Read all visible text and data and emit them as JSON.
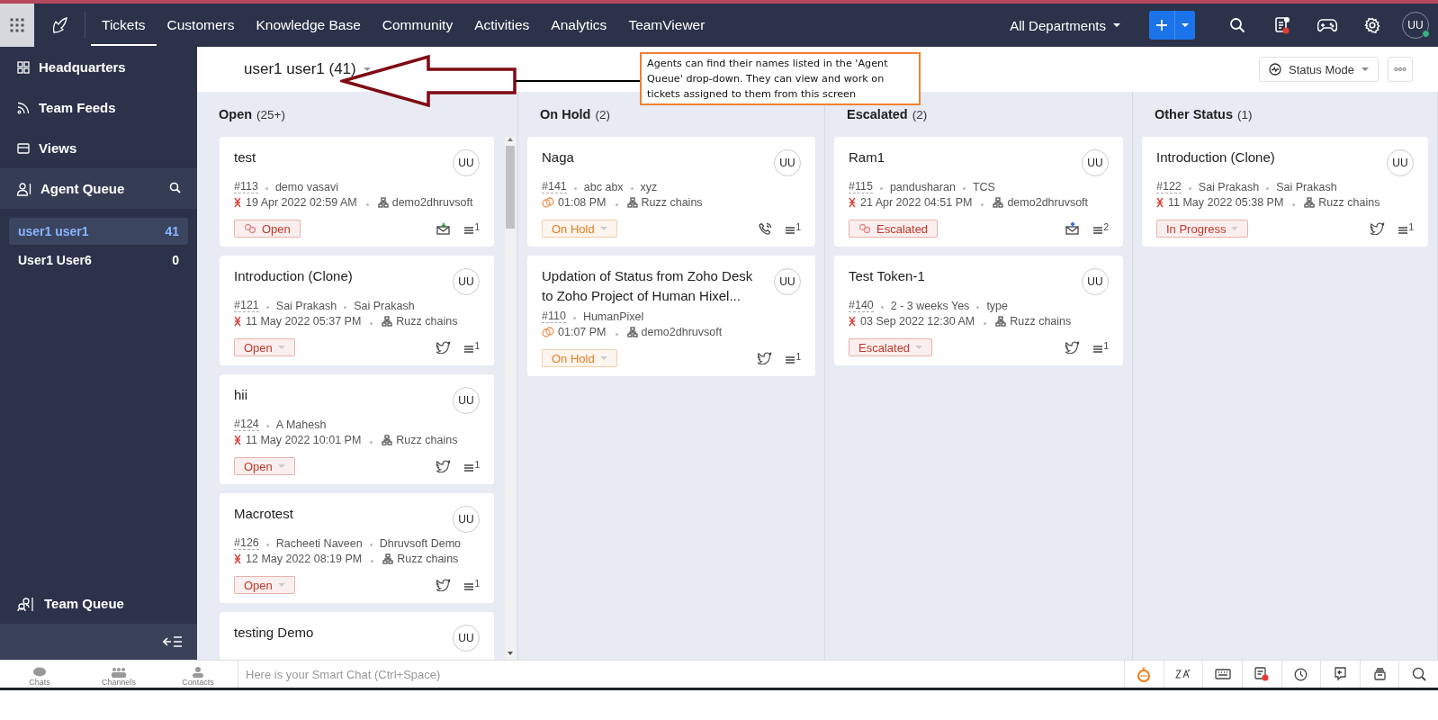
{
  "top_nav": {
    "tabs": [
      {
        "label": "Tickets",
        "selected": true
      },
      {
        "label": "Customers",
        "selected": false
      },
      {
        "label": "Knowledge Base",
        "selected": false
      },
      {
        "label": "Community",
        "selected": false
      },
      {
        "label": "Activities",
        "selected": false
      },
      {
        "label": "Analytics",
        "selected": false
      },
      {
        "label": "TeamViewer",
        "selected": false
      }
    ],
    "department": "All Departments",
    "avatar": "UU"
  },
  "sidebar": {
    "items": [
      {
        "label": "Headquarters",
        "kind": "headquarters",
        "selected": false
      },
      {
        "label": "Team Feeds",
        "kind": "feeds",
        "selected": false
      },
      {
        "label": "Views",
        "kind": "views",
        "selected": false
      },
      {
        "label": "Agent Queue",
        "kind": "agent",
        "selected": true
      }
    ],
    "agents": [
      {
        "name": "user1 user1",
        "count": "41",
        "selected": true
      },
      {
        "name": "User1 User6",
        "count": "0",
        "selected": false
      }
    ],
    "footer_item": "Team Queue"
  },
  "view_header": {
    "title": "user1 user1 (41)",
    "status_mode": "Status Mode"
  },
  "annotation": {
    "text": "Agents can find their names listed in the 'Agent Queue' drop-down. They can view and work on tickets assigned to them from this screen"
  },
  "columns": [
    {
      "title": "Open",
      "count": "(25+)",
      "cards": [
        {
          "subject": "test",
          "number": "#113",
          "meta": [
            "demo vasavi"
          ],
          "time": {
            "kind": "due",
            "text": "19 Apr 2022 02:59 AM"
          },
          "department": "demo2dhruvsoft",
          "status": {
            "label": "Open",
            "color": "#c0392b",
            "linked": true
          },
          "channel": {
            "kind": "email-in"
          },
          "threads": "1",
          "avatar": "UU"
        },
        {
          "subject": "Introduction (Clone)",
          "number": "#121",
          "meta": [
            "Sai Prakash",
            "Sai Prakash"
          ],
          "time": {
            "kind": "due",
            "text": "11 May 2022 05:37 PM"
          },
          "department": "Ruzz chains",
          "status": {
            "label": "Open",
            "color": "#c0392b",
            "linked": false
          },
          "channel": {
            "kind": "twitter"
          },
          "threads": "1",
          "avatar": "UU"
        },
        {
          "subject": "hii",
          "number": "#124",
          "meta": [
            "A Mahesh"
          ],
          "time": {
            "kind": "due",
            "text": "11 May 2022 10:01 PM"
          },
          "department": "Ruzz chains",
          "status": {
            "label": "Open",
            "color": "#c0392b",
            "linked": false
          },
          "channel": {
            "kind": "twitter"
          },
          "threads": "1",
          "avatar": "UU"
        },
        {
          "subject": "Macrotest",
          "number": "#126",
          "meta": [
            "Racheeti Naveen",
            "Dhruvsoft Demo"
          ],
          "time": {
            "kind": "due",
            "text": "12 May 2022 08:19 PM"
          },
          "department": "Ruzz chains",
          "status": {
            "label": "Open",
            "color": "#c0392b",
            "linked": false
          },
          "channel": {
            "kind": "twitter"
          },
          "threads": "1",
          "avatar": "UU"
        },
        {
          "subject": "testing Demo",
          "avatar": "UU"
        }
      ]
    },
    {
      "title": "On Hold",
      "count": "(2)",
      "cards": [
        {
          "subject": "Naga",
          "number": "#141",
          "meta": [
            "abc abx",
            "xyz"
          ],
          "time": {
            "kind": "hold",
            "text": "01:08 PM"
          },
          "department": "Ruzz chains",
          "status": {
            "label": "On Hold",
            "color": "#e67e22",
            "linked": false
          },
          "channel": {
            "kind": "phone"
          },
          "threads": "1",
          "avatar": "UU"
        },
        {
          "subject": "Updation of Status from Zoho Desk to Zoho Project of Human Hixel...",
          "number": "#110",
          "meta": [
            "HumanPixel"
          ],
          "time": {
            "kind": "hold",
            "text": "01:07 PM"
          },
          "department": "demo2dhruvsoft",
          "status": {
            "label": "On Hold",
            "color": "#e67e22",
            "linked": false
          },
          "channel": {
            "kind": "twitter"
          },
          "threads": "1",
          "avatar": "UU"
        }
      ]
    },
    {
      "title": "Escalated",
      "count": "(2)",
      "cards": [
        {
          "subject": "Ram1",
          "number": "#115",
          "meta": [
            "pandusharan",
            "TCS"
          ],
          "time": {
            "kind": "due",
            "text": "21 Apr 2022 04:51 PM"
          },
          "department": "demo2dhruvsoft",
          "status": {
            "label": "Escalated",
            "color": "#c0392b",
            "linked": true
          },
          "channel": {
            "kind": "email-out"
          },
          "threads": "2",
          "avatar": "UU"
        },
        {
          "subject": "Test Token-1",
          "number": "#140",
          "meta": [
            "2 - 3 weeks Yes",
            "type"
          ],
          "time": {
            "kind": "due",
            "text": "03 Sep 2022 12:30 AM"
          },
          "department": "Ruzz chains",
          "status": {
            "label": "Escalated",
            "color": "#c0392b",
            "linked": false
          },
          "channel": {
            "kind": "twitter"
          },
          "threads": "1",
          "avatar": "UU"
        }
      ]
    },
    {
      "title": "Other Status",
      "count": "(1)",
      "cards": [
        {
          "subject": "Introduction (Clone)",
          "number": "#122",
          "meta": [
            "Sai Prakash",
            "Sai Prakash"
          ],
          "time": {
            "kind": "due",
            "text": "11 May 2022 05:38 PM"
          },
          "department": "Ruzz chains",
          "status": {
            "label": "In Progress",
            "color": "#c0392b",
            "linked": false
          },
          "channel": {
            "kind": "twitter"
          },
          "threads": "1",
          "avatar": "UU"
        }
      ]
    }
  ],
  "chat_bar": {
    "tabs": [
      "Chats",
      "Channels",
      "Contacts"
    ],
    "placeholder": "Here is your Smart Chat (Ctrl+Space)"
  }
}
